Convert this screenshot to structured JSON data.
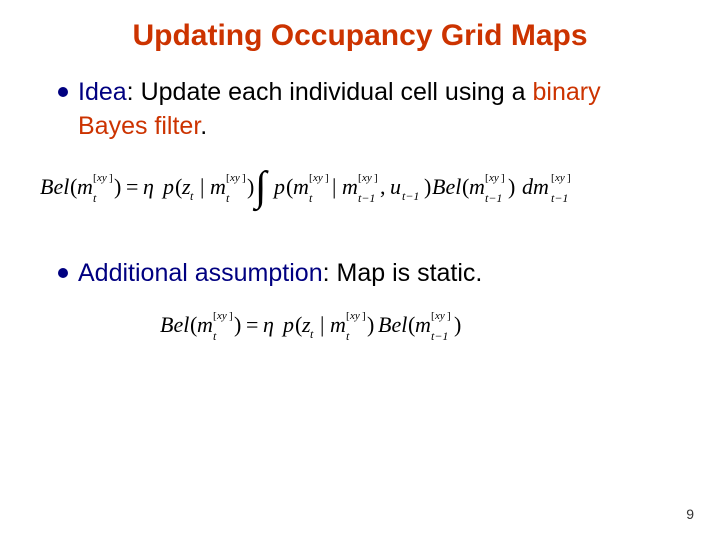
{
  "title": "Updating Occupancy Grid Maps",
  "bullets": [
    {
      "lead": "Idea",
      "lead_sep": ": ",
      "rest_a": "Update each individual cell using a ",
      "rest_b_colored": "binary Bayes filter",
      "rest_c": "."
    },
    {
      "lead": "Additional assumption",
      "lead_sep": ": ",
      "rest_a": "Map is static.",
      "rest_b_colored": "",
      "rest_c": ""
    }
  ],
  "formulas": {
    "f1": "Bel(m_t^[xy]) = η p(z_t | m_t^[xy]) ∫ p(m_t^[xy] | m_{t-1}^[xy], u_{t-1}) Bel(m_{t-1}^[xy]) dm_{t-1}^[xy]",
    "f2": "Bel(m_t^[xy]) = η p(z_t | m_t^[xy]) Bel(m_{t-1}^[xy])"
  },
  "page_number": "9"
}
